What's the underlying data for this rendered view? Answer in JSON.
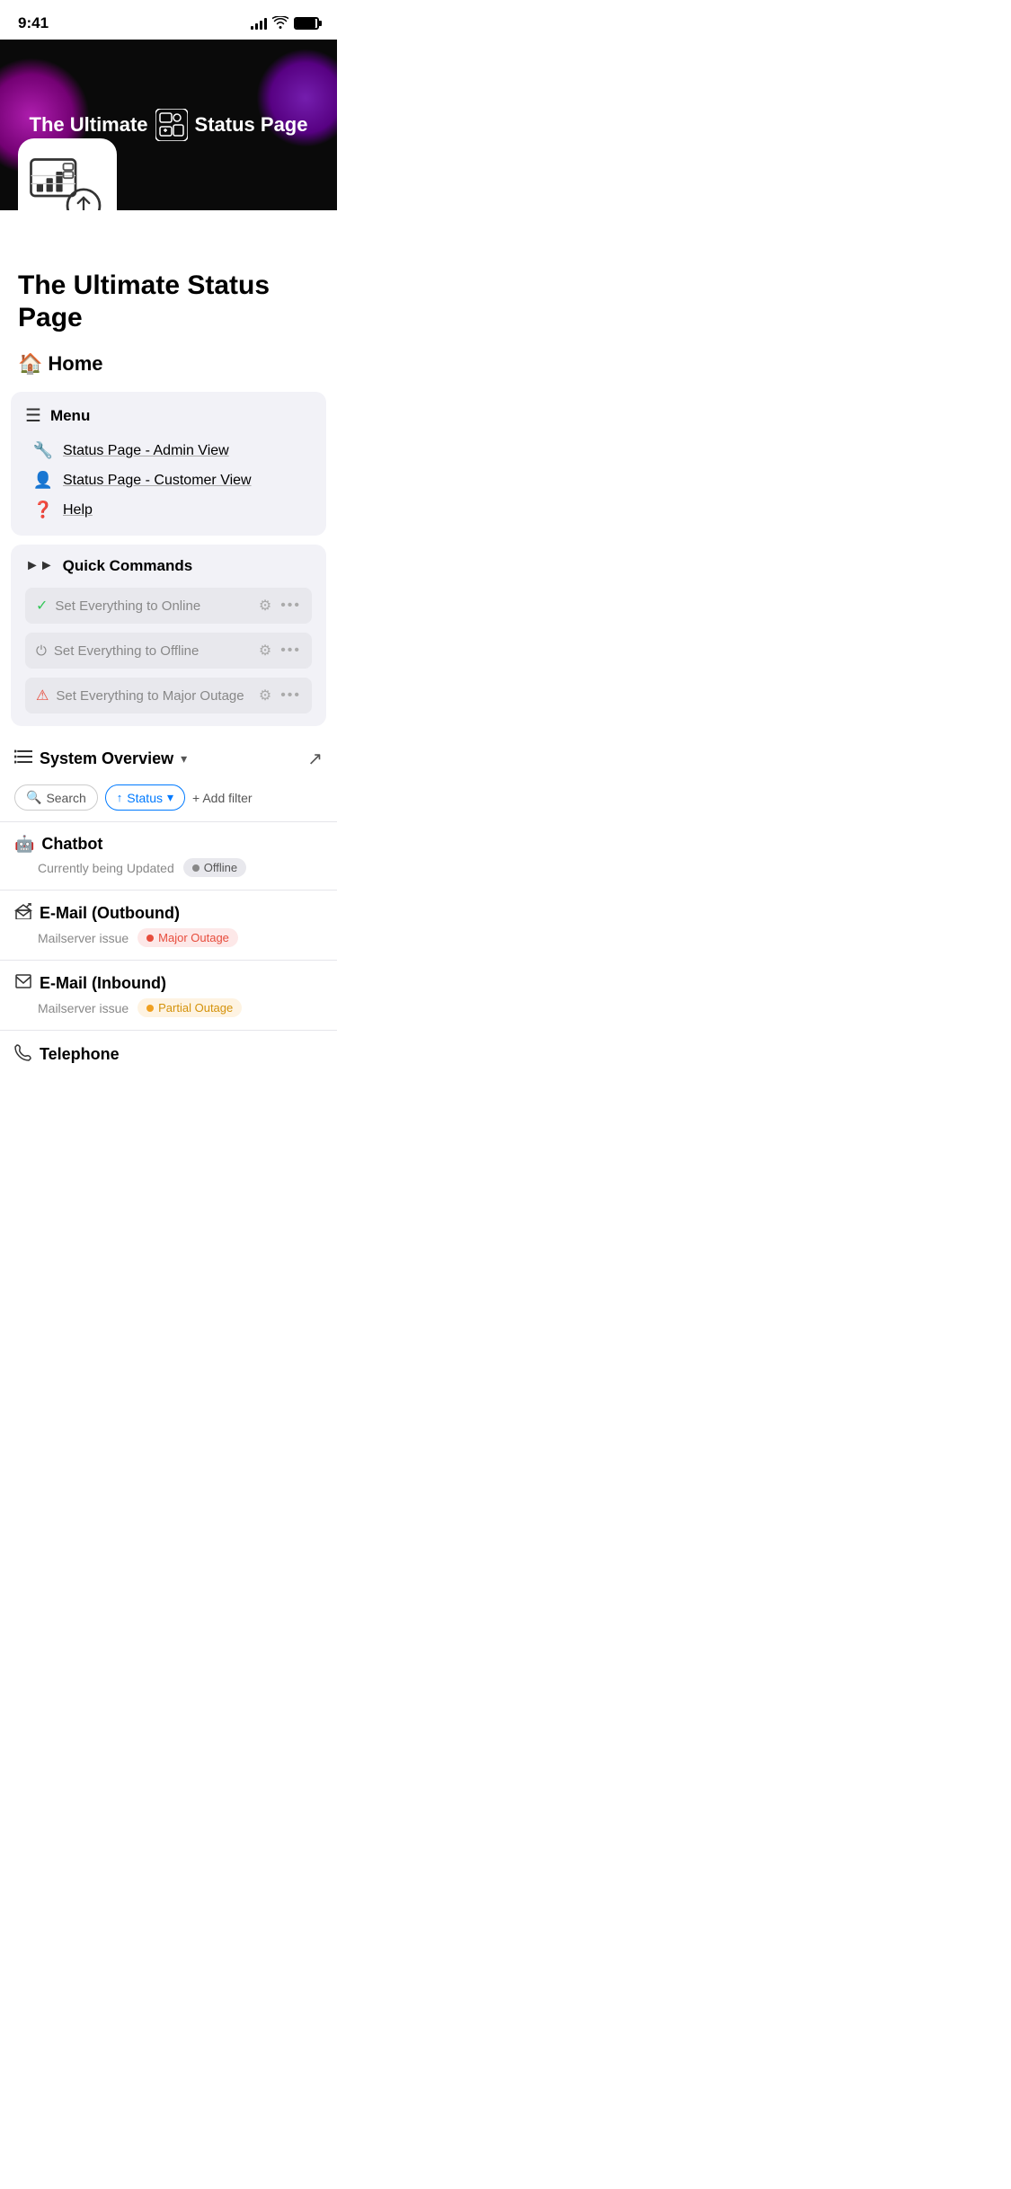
{
  "statusBar": {
    "time": "9:41"
  },
  "hero": {
    "title1": "The Ultimate",
    "title2": "Status Page"
  },
  "pageTitle": "The Ultimate Status Page",
  "home": {
    "emoji": "🏠",
    "label": "Home"
  },
  "menu": {
    "title": "Menu",
    "items": [
      {
        "icon": "🔧",
        "label": "Status Page - Admin View"
      },
      {
        "icon": "👤",
        "label": "Status Page - Customer View"
      },
      {
        "icon": "❓",
        "label": "Help"
      }
    ]
  },
  "quickCommands": {
    "title": "Quick Commands",
    "items": [
      {
        "label": "Set Everything to Online",
        "iconType": "check"
      },
      {
        "label": "Set Everything to Offline",
        "iconType": "power"
      },
      {
        "label": "Set Everything to Major Outage",
        "iconType": "warning"
      }
    ]
  },
  "systemOverview": {
    "title": "System Overview"
  },
  "filters": {
    "searchLabel": "Search",
    "statusLabel": "Status",
    "addFilterLabel": "+ Add filter"
  },
  "services": [
    {
      "icon": "🤖",
      "name": "Chatbot",
      "detail": "Currently being Updated",
      "statusType": "offline",
      "statusLabel": "Offline"
    },
    {
      "icon": "✉️",
      "name": "E-Mail (Outbound)",
      "detail": "Mailserver issue",
      "statusType": "major-outage",
      "statusLabel": "Major Outage"
    },
    {
      "icon": "📥",
      "name": "E-Mail (Inbound)",
      "detail": "Mailserver issue",
      "statusType": "partial-outage",
      "statusLabel": "Partial Outage"
    },
    {
      "icon": "📞",
      "name": "Telephone",
      "detail": "",
      "statusType": "",
      "statusLabel": ""
    }
  ]
}
